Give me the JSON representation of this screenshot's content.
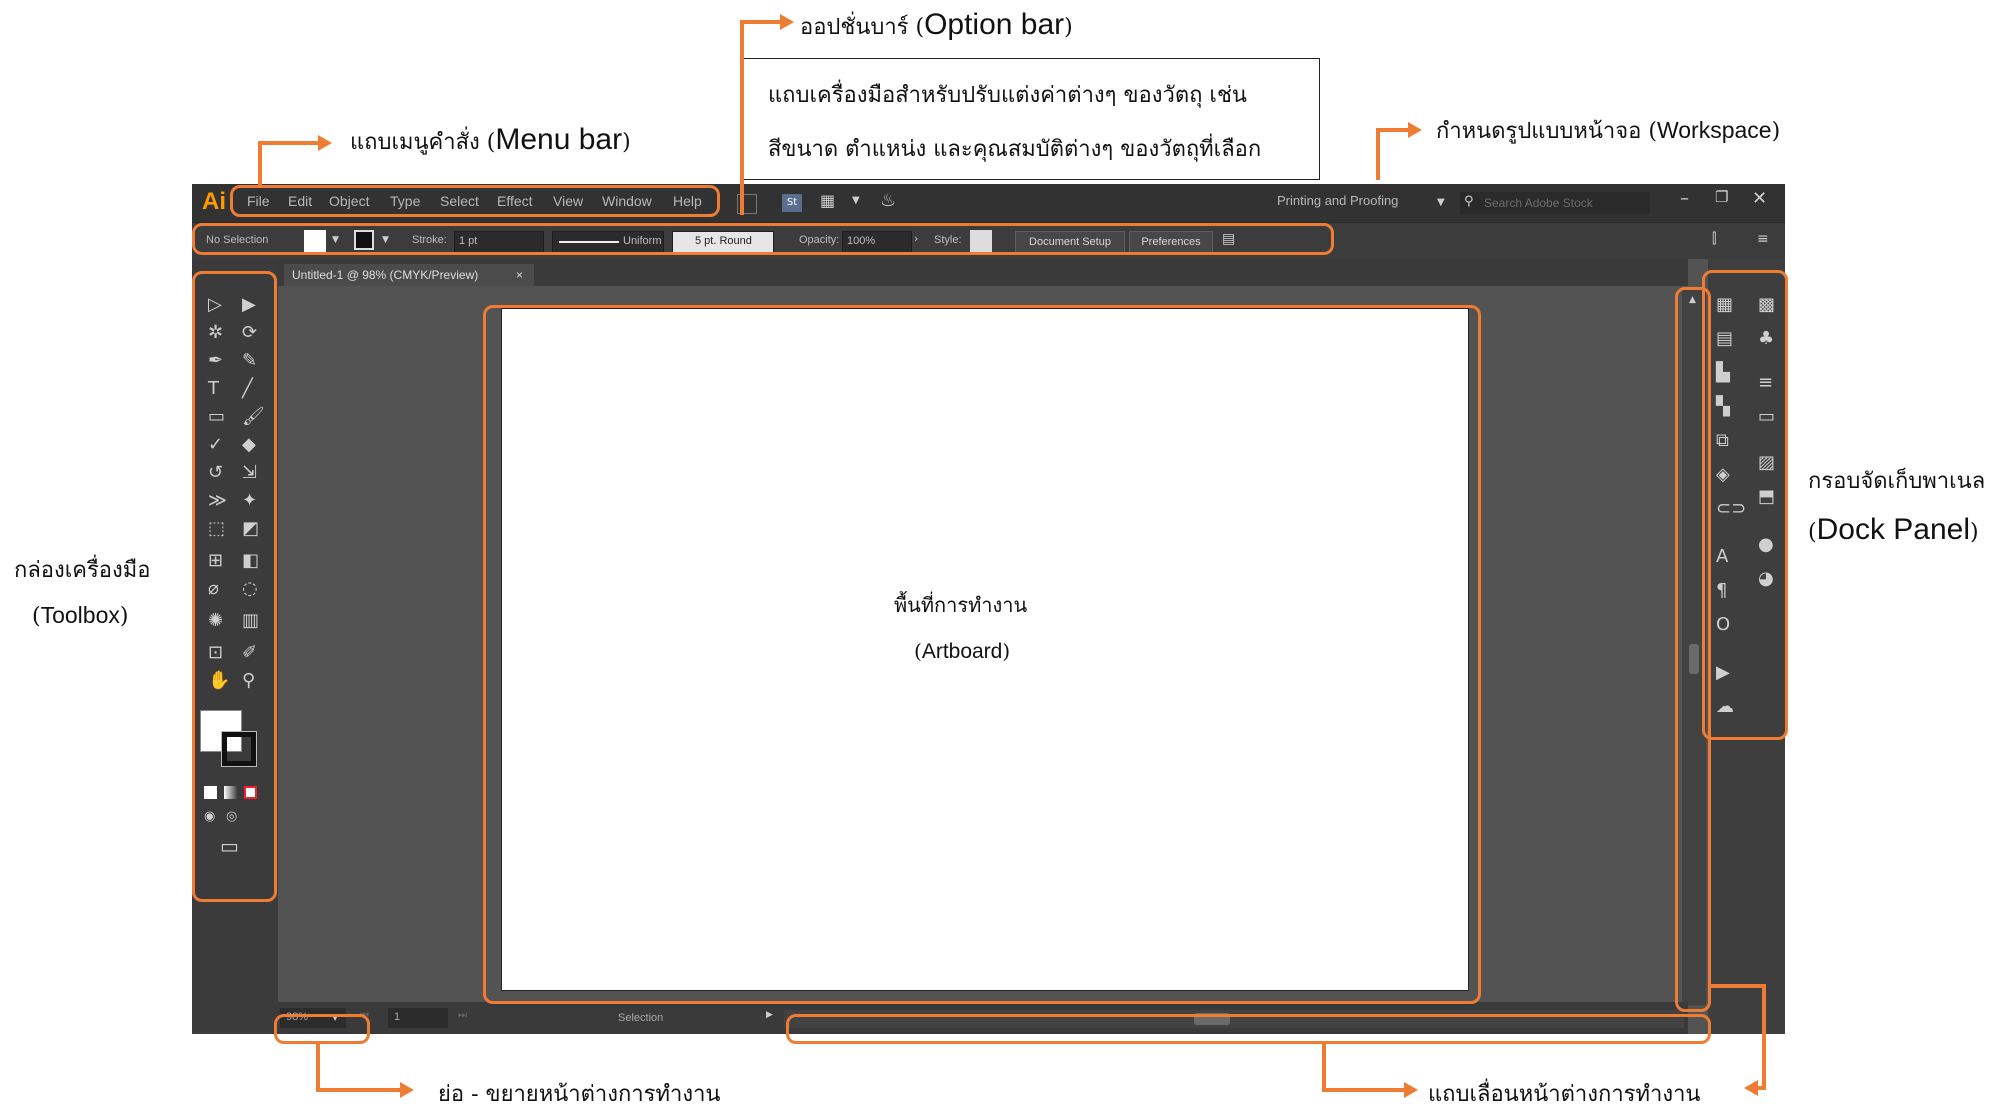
{
  "annotations": {
    "option_bar": {
      "thai": "ออปชั่นบาร์ (",
      "en": "Option bar",
      "close": ")"
    },
    "option_desc_line1": "แถบเครื่องมือสำหรับปรับแต่งค่าต่างๆ ของวัตถุ เช่น",
    "option_desc_line2": "สีขนาด ตำแหน่ง และคุณสมบัติต่างๆ ของวัตถุที่เลือก",
    "menu_bar": {
      "thai": "แถบเมนูคำสั่ง (",
      "en": "Menu bar",
      "close": ")"
    },
    "workspace": {
      "thai": "กำหนดรูปแบบหน้าจอ (",
      "en": "Workspace",
      "close": ")"
    },
    "toolbox_thai": "กล่องเครื่องมือ",
    "toolbox_en": {
      "open": "(",
      "en": "Toolbox",
      "close": ")"
    },
    "dock_thai": "กรอบจัดเก็บพาเนล",
    "dock_en": {
      "open": "(",
      "en": "Dock Panel",
      "close": ")"
    },
    "artboard_thai": "พื้นที่การทำงาน",
    "artboard_en": {
      "open": "(",
      "en": "Artboard",
      "close": ")"
    },
    "zoom": "ย่อ - ขยายหน้าต่างการทำงาน",
    "scroll": "แถบเลื่อนหน้าต่างการทำงาน"
  },
  "app": {
    "logo": "Ai",
    "menu": [
      "File",
      "Edit",
      "Object",
      "Type",
      "Select",
      "Effect",
      "View",
      "Window",
      "Help"
    ],
    "workspace_select": "Printing and Proofing",
    "search_placeholder": "Search Adobe Stock",
    "option_bar": {
      "selection": "No Selection",
      "stroke_label": "Stroke:",
      "stroke_value": "1 pt",
      "uniform": "Uniform",
      "brush": "5 pt. Round",
      "opacity_label": "Opacity:",
      "opacity_value": "100%",
      "style_label": "Style:",
      "document_setup": "Document Setup",
      "preferences": "Preferences"
    },
    "doc_tab": "Untitled-1 @ 98% (CMYK/Preview)",
    "status": {
      "zoom": "98%",
      "artboard_num": "1",
      "tool": "Selection"
    }
  },
  "colors": {
    "accent": "#ee7d33",
    "ui_dark": "#323232",
    "ui_mid": "#535353",
    "ai_orange": "#ff9a00"
  }
}
